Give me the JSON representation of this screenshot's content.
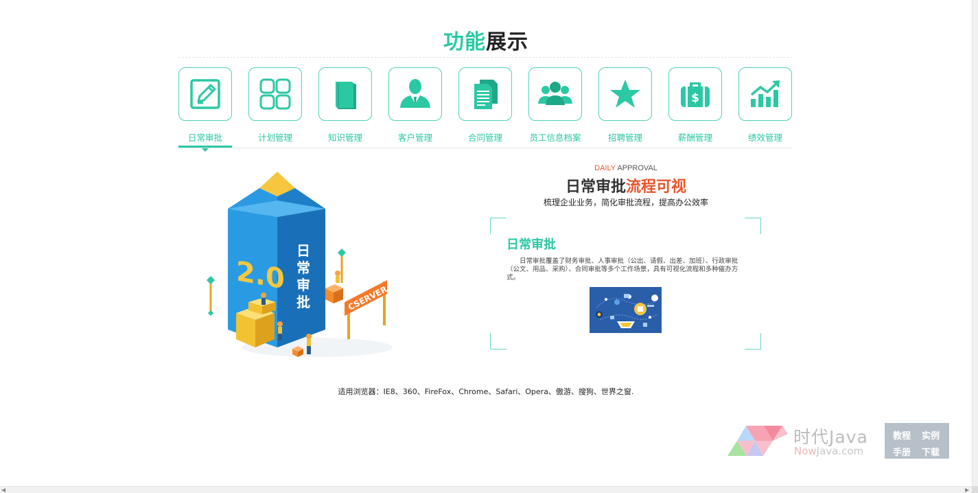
{
  "title": {
    "part1": "功能",
    "part2": "展示"
  },
  "tabs": [
    {
      "label": "日常审批",
      "icon": "pencil-edit-icon",
      "active": true
    },
    {
      "label": "计划管理",
      "icon": "grid-squares-icon"
    },
    {
      "label": "知识管理",
      "icon": "book-icon"
    },
    {
      "label": "客户管理",
      "icon": "person-icon"
    },
    {
      "label": "合同管理",
      "icon": "document-icon"
    },
    {
      "label": "员工信息档案",
      "icon": "group-people-icon"
    },
    {
      "label": "招聘管理",
      "icon": "star-icon"
    },
    {
      "label": "薪酬管理",
      "icon": "money-bag-icon"
    },
    {
      "label": "绩效管理",
      "icon": "bar-trend-icon"
    }
  ],
  "illustration": {
    "version": "2.0",
    "vertical_text": [
      "日",
      "常",
      "审",
      "批"
    ],
    "sign": "CSERVER"
  },
  "detail": {
    "tag_red": "DAILY",
    "tag_dark": " APPROVAL",
    "headline_dark": "日常审批",
    "headline_red": "流程可视",
    "subline": "梳理企业业务，简化审批流程，提高办公效率",
    "card_title": "日常审批",
    "card_desc": "日常审批覆盖了财务审批、人事审批（公出、请假、出差、加班）、行政审批（公文、用品、采购）、合同审批等多个工作场景，具有可视化流程和多种催办方式。"
  },
  "footer": {
    "browsers": "适用浏览器：IE8、360、FireFox、Chrome、Safari、Opera、傲游、搜狗、世界之窗."
  },
  "watermark": {
    "brand_cn": "时代Java",
    "brand_now": "Now",
    "brand_en": "Java.com",
    "links": [
      "教程",
      "实例",
      "手册",
      "下载"
    ]
  },
  "colors": {
    "accent": "#2bc8a4",
    "red": "#e8552b",
    "dark": "#222222"
  }
}
